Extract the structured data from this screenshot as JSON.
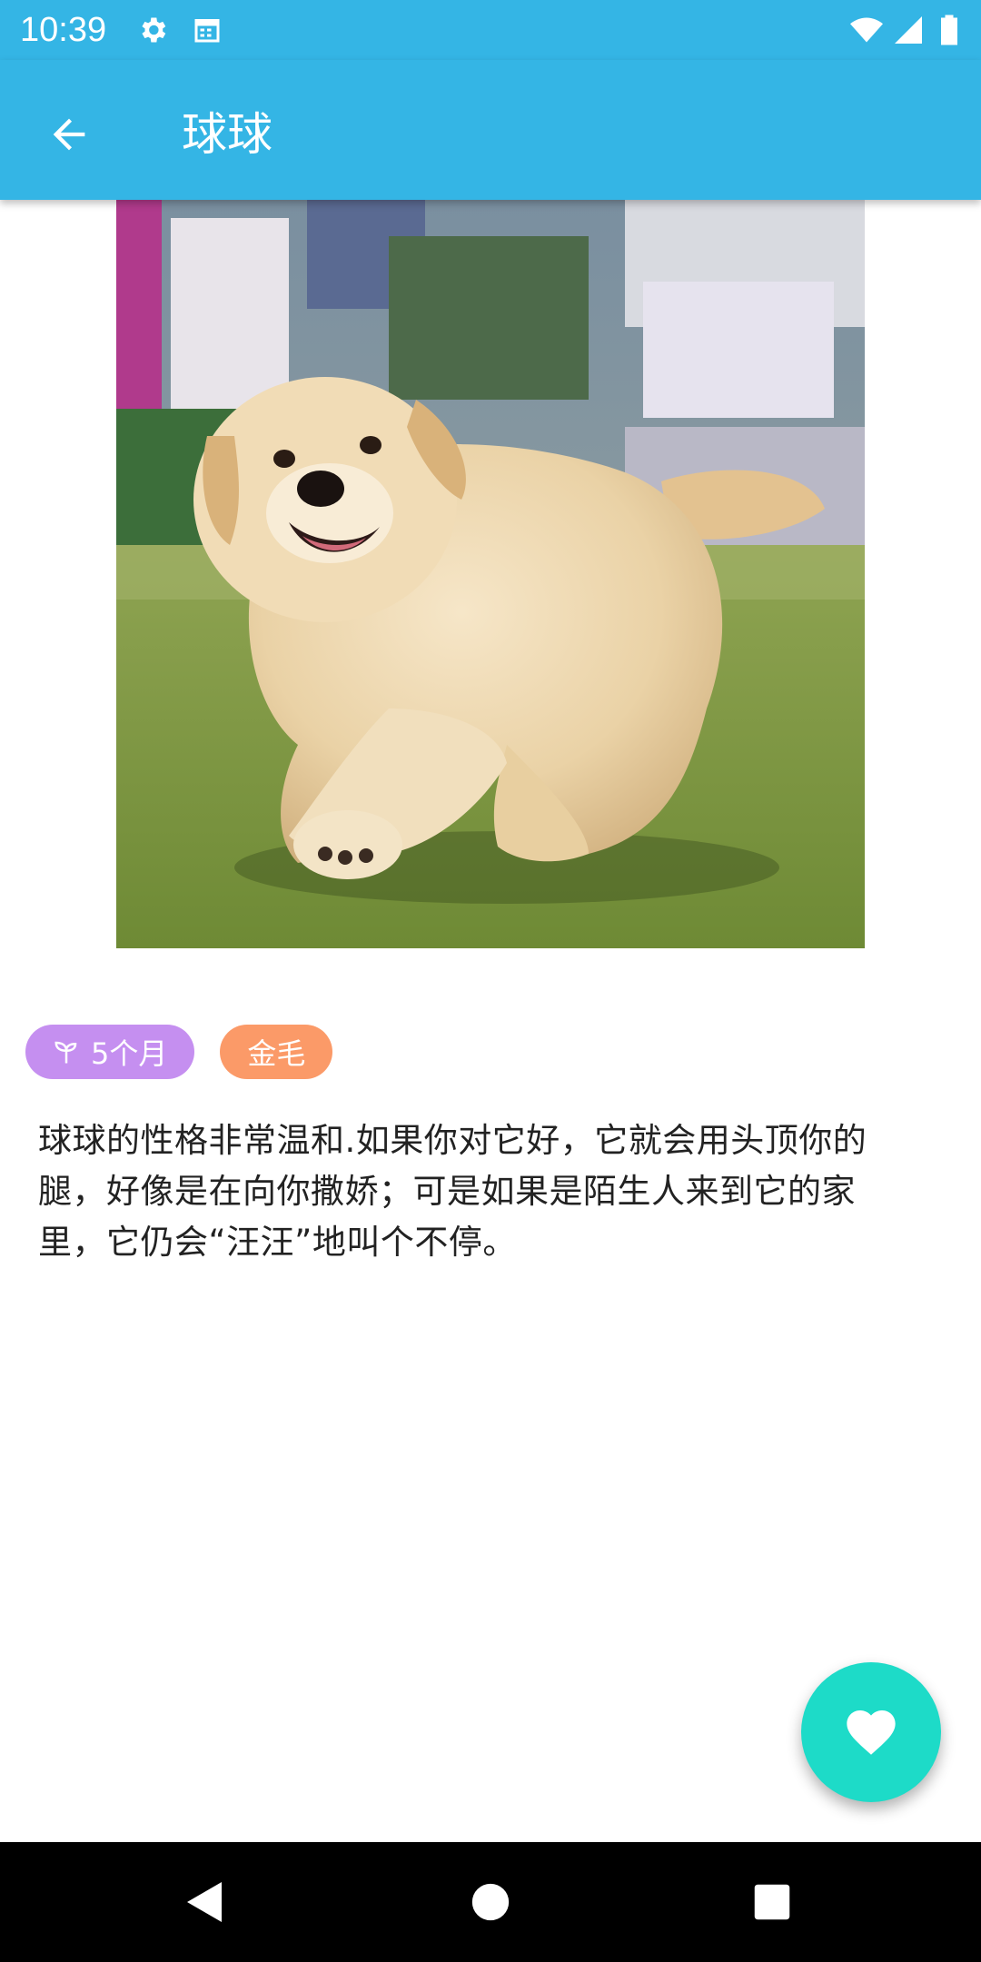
{
  "status_bar": {
    "time": "10:39",
    "icons": [
      "settings-icon",
      "calendar-icon",
      "wifi-icon",
      "signal-icon",
      "battery-icon"
    ]
  },
  "app_bar": {
    "title": "球球",
    "back_icon": "arrow-back-icon"
  },
  "pet": {
    "photo": "golden-retriever-puppy-photo",
    "tags": [
      {
        "icon": "sprout-icon",
        "label": "5个月",
        "color": "#c58ff0"
      },
      {
        "label": "金毛",
        "color": "#fb9a68"
      }
    ],
    "description": "球球的性格非常温和.如果你对它好，它就会用头顶你的腿，好像是在向你撒娇；可是如果是陌生人来到它的家里，它仍会“汪汪”地叫个不停。"
  },
  "fab": {
    "icon": "heart-icon",
    "color": "#1ddbc8"
  },
  "nav": {
    "icons": [
      "back-triangle-icon",
      "home-circle-icon",
      "recents-square-icon"
    ]
  },
  "colors": {
    "primary": "#34b5e5",
    "accent": "#1ddbc8"
  }
}
